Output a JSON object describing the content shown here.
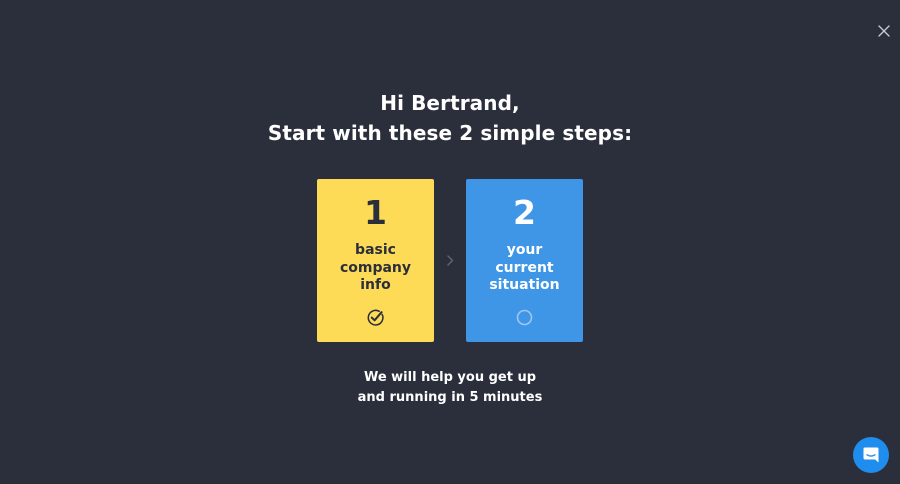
{
  "heading": {
    "greeting": "Hi Bertrand,",
    "subtitle": "Start with these 2 simple steps:"
  },
  "steps": [
    {
      "number": "1",
      "label_lines": [
        "basic",
        "company",
        "info"
      ],
      "status": "completed",
      "status_icon": "check-circle-icon",
      "background": "#fddb56",
      "text_color": "#2b2f3b"
    },
    {
      "number": "2",
      "label_lines": [
        "your",
        "current",
        "situation"
      ],
      "status": "pending",
      "status_icon": "empty-circle-icon",
      "background": "#3f96e6",
      "text_color": "#ffffff"
    }
  ],
  "footer": {
    "line1": "We will help you get up",
    "line2": "and running in 5 minutes"
  },
  "icons": {
    "close": "close-icon",
    "separator": "chevron-right-icon",
    "chat": "chat-icon"
  },
  "colors": {
    "background": "#2b2f3b",
    "chat_button": "#1f8ded"
  }
}
